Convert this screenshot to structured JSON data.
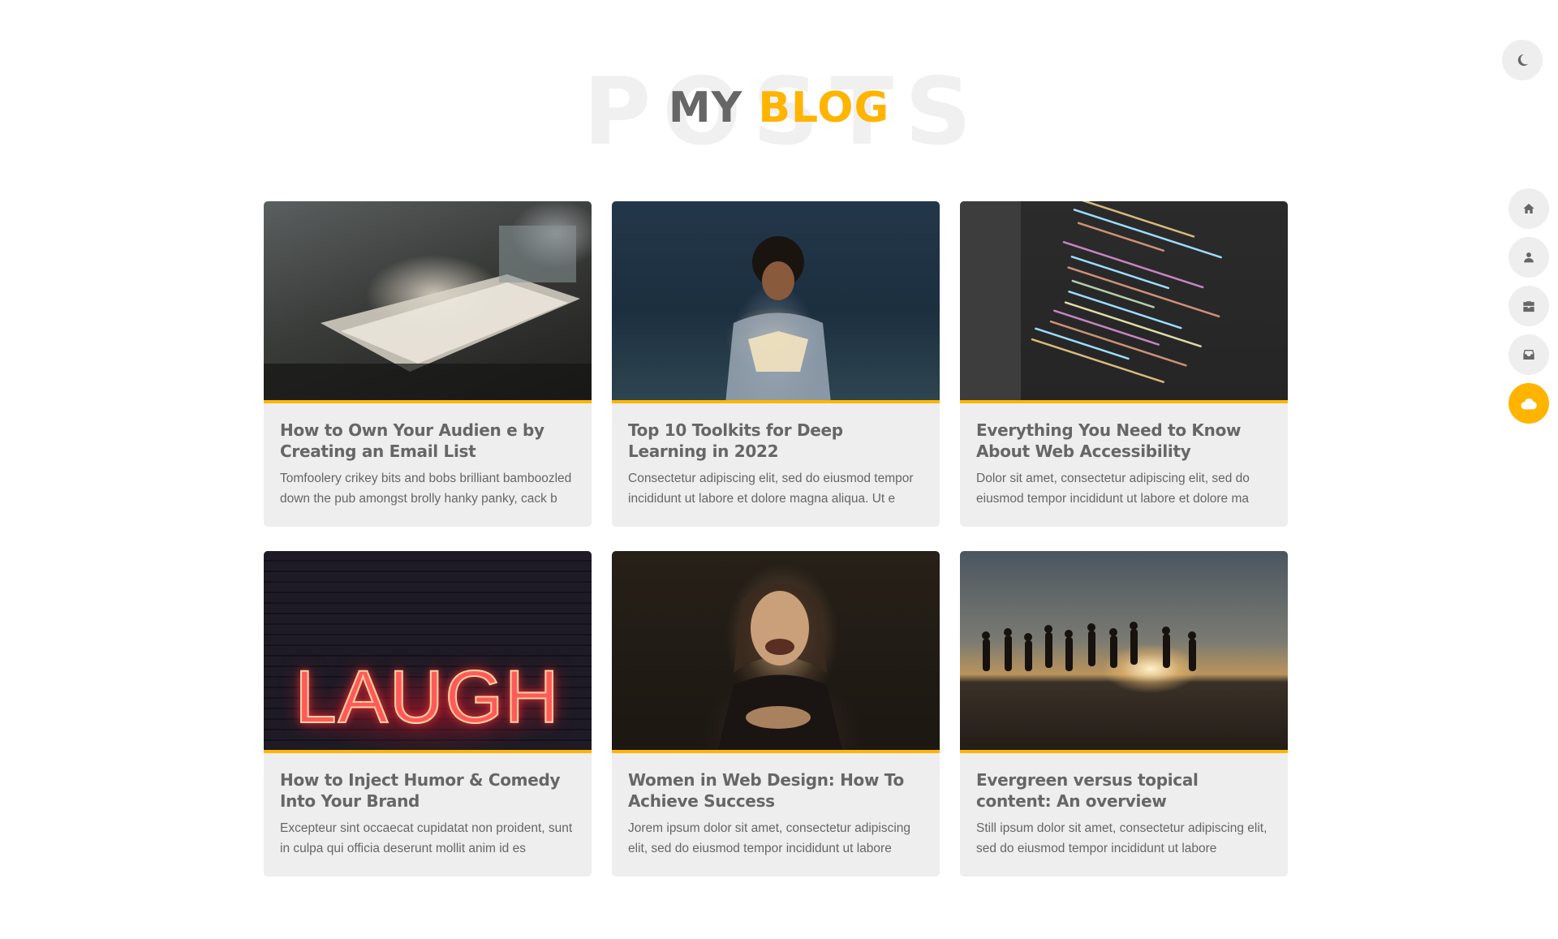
{
  "theme_toggle": {
    "icon": "moon-icon"
  },
  "header": {
    "watermark": "POSTS",
    "title_part1": "MY",
    "title_part2": "BLOG"
  },
  "nav": {
    "items": [
      {
        "icon": "home-icon",
        "active": false
      },
      {
        "icon": "user-icon",
        "active": false
      },
      {
        "icon": "briefcase-icon",
        "active": false
      },
      {
        "icon": "mailbox-icon",
        "active": false
      },
      {
        "icon": "cloud-icon",
        "active": true
      }
    ]
  },
  "posts": [
    {
      "title": "How to Own Your Audien e by Creating an Email List",
      "excerpt": "Tomfoolery crikey bits and bobs brilliant bamboozled down the pub amongst brolly hanky panky, cack b"
    },
    {
      "title": "Top 10 Toolkits for Deep Learning in 2022",
      "excerpt": "Consectetur adipiscing elit, sed do eiusmod tempor incididunt ut labore et dolore magna aliqua. Ut e"
    },
    {
      "title": "Everything You Need to Know About Web Accessibility",
      "excerpt": "Dolor sit amet, consectetur adipiscing elit, sed do eiusmod tempor incididunt ut labore et dolore ma"
    },
    {
      "title": "How to Inject Humor & Comedy Into Your Brand",
      "excerpt": "Excepteur sint occaecat cupidatat non proident, sunt in culpa qui officia deserunt mollit anim id es",
      "image_text": "LAUGH"
    },
    {
      "title": "Women in Web Design: How To Achieve Success",
      "excerpt": "Jorem ipsum dolor sit amet, consectetur adipiscing elit, sed do eiusmod tempor incididunt ut labore"
    },
    {
      "title": "Evergreen versus topical content: An overview",
      "excerpt": "Still ipsum dolor sit amet, consectetur adipiscing elit, sed do eiusmod tempor incididunt ut labore"
    }
  ],
  "colors": {
    "accent": "#ffb400",
    "text": "#666666",
    "card_bg": "#eeeeee"
  }
}
